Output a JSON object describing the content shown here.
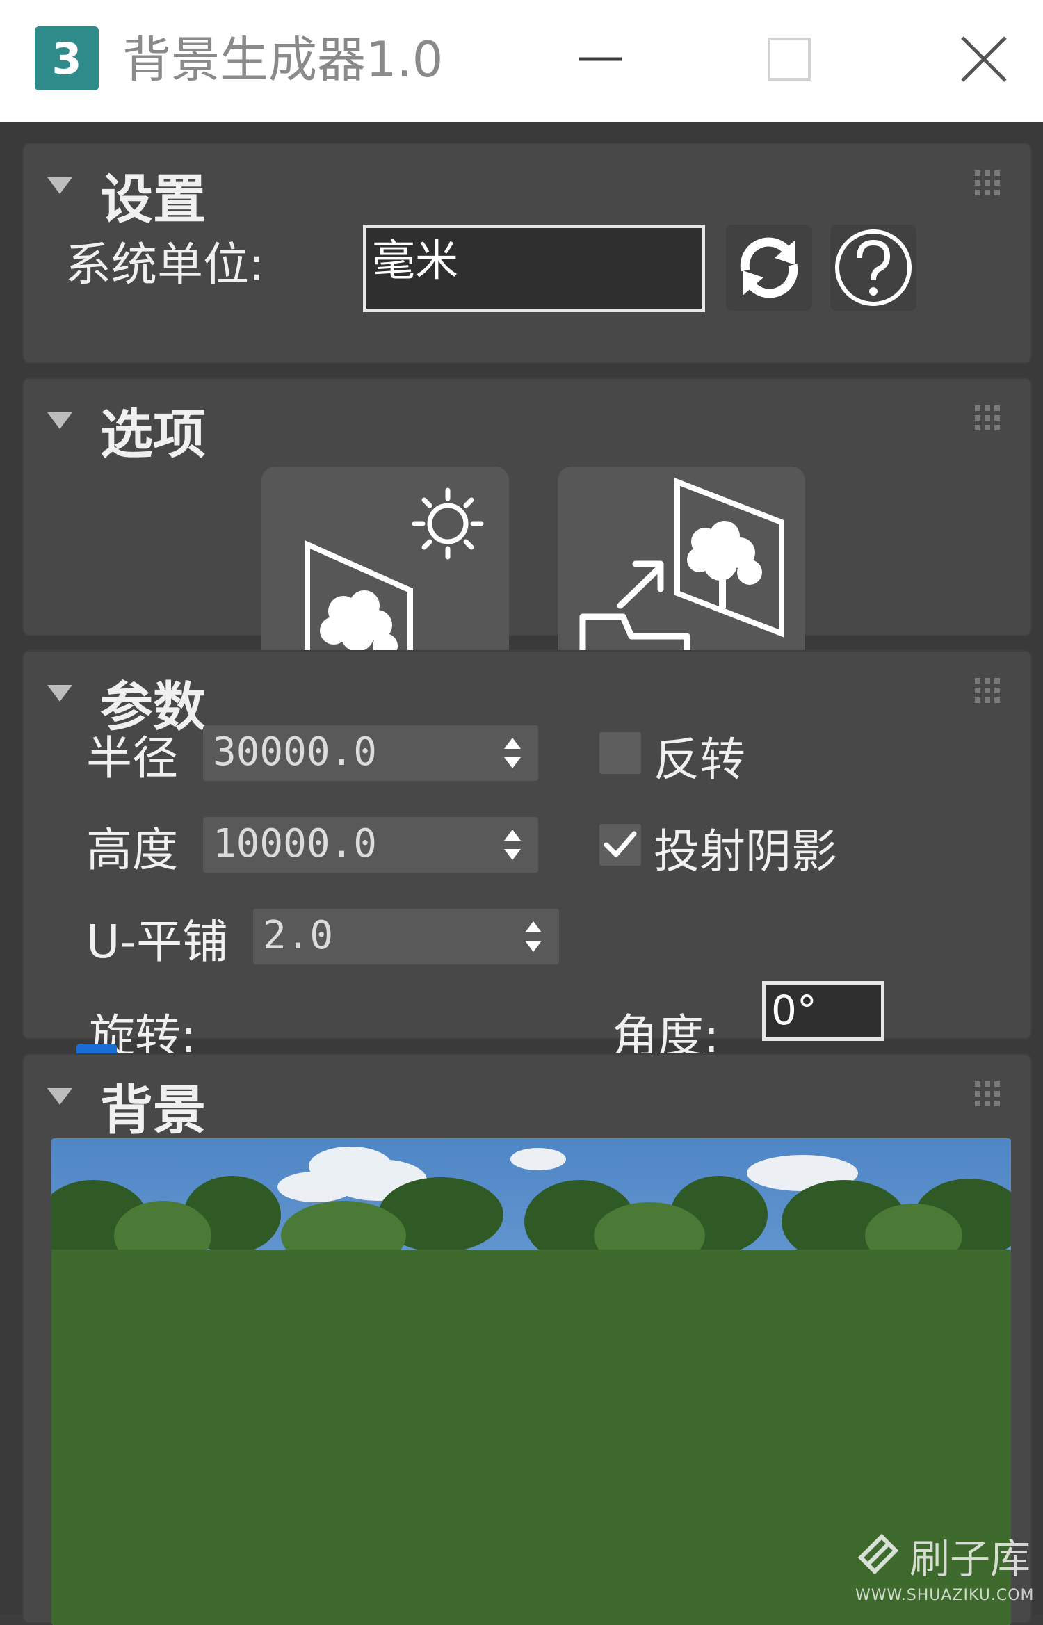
{
  "window": {
    "title": "背景生成器1.0",
    "app_icon_glyph": "3"
  },
  "settings": {
    "header": "设置",
    "unit_label": "系统单位:",
    "unit_value": "毫米",
    "refresh_icon": "refresh-icon",
    "help_icon": "help-icon"
  },
  "options": {
    "header": "选项",
    "buttons": [
      "create-background-icon",
      "import-background-icon"
    ]
  },
  "params": {
    "header": "参数",
    "radius_label": "半径",
    "radius_value": "30000.0",
    "height_label": "高度",
    "height_value": "10000.0",
    "utile_label": "U-平铺",
    "utile_value": "2.0",
    "flip_label": "反转",
    "flip_checked": false,
    "shadow_label": "投射阴影",
    "shadow_checked": true,
    "rotate_label": "旋转:",
    "angle_label": "角度:",
    "angle_value": "0°",
    "rotation_fraction": 0.0
  },
  "background": {
    "header": "背景"
  },
  "watermark": {
    "brand": "刷子库",
    "url": "WWW.SHUAZIKU.COM"
  },
  "colors": {
    "panel": "#484848",
    "accent_blue": "#1a6fd6",
    "title_bg": "#ffffff"
  }
}
